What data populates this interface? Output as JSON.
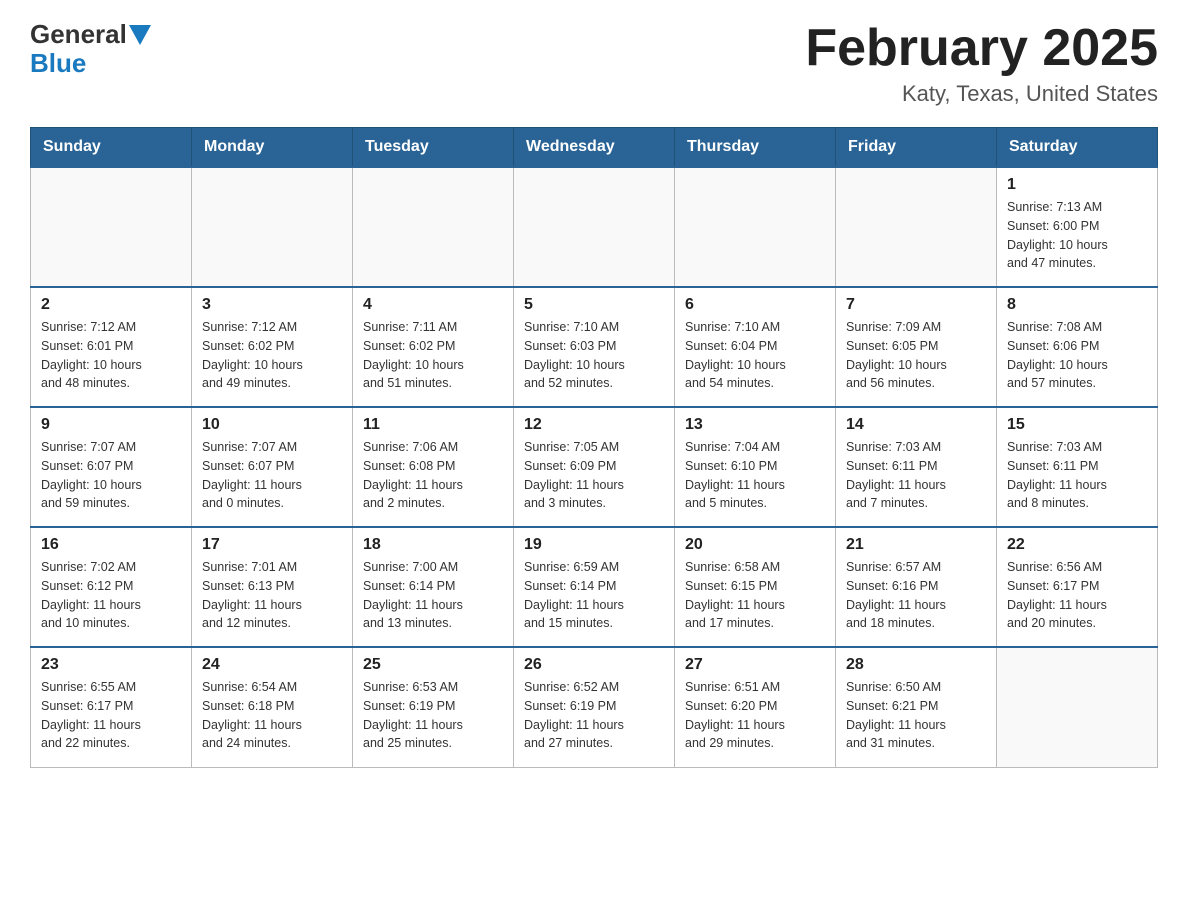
{
  "header": {
    "logo_general": "General",
    "logo_blue": "Blue",
    "title": "February 2025",
    "subtitle": "Katy, Texas, United States"
  },
  "days_of_week": [
    "Sunday",
    "Monday",
    "Tuesday",
    "Wednesday",
    "Thursday",
    "Friday",
    "Saturday"
  ],
  "weeks": [
    [
      {
        "day": "",
        "info": ""
      },
      {
        "day": "",
        "info": ""
      },
      {
        "day": "",
        "info": ""
      },
      {
        "day": "",
        "info": ""
      },
      {
        "day": "",
        "info": ""
      },
      {
        "day": "",
        "info": ""
      },
      {
        "day": "1",
        "info": "Sunrise: 7:13 AM\nSunset: 6:00 PM\nDaylight: 10 hours\nand 47 minutes."
      }
    ],
    [
      {
        "day": "2",
        "info": "Sunrise: 7:12 AM\nSunset: 6:01 PM\nDaylight: 10 hours\nand 48 minutes."
      },
      {
        "day": "3",
        "info": "Sunrise: 7:12 AM\nSunset: 6:02 PM\nDaylight: 10 hours\nand 49 minutes."
      },
      {
        "day": "4",
        "info": "Sunrise: 7:11 AM\nSunset: 6:02 PM\nDaylight: 10 hours\nand 51 minutes."
      },
      {
        "day": "5",
        "info": "Sunrise: 7:10 AM\nSunset: 6:03 PM\nDaylight: 10 hours\nand 52 minutes."
      },
      {
        "day": "6",
        "info": "Sunrise: 7:10 AM\nSunset: 6:04 PM\nDaylight: 10 hours\nand 54 minutes."
      },
      {
        "day": "7",
        "info": "Sunrise: 7:09 AM\nSunset: 6:05 PM\nDaylight: 10 hours\nand 56 minutes."
      },
      {
        "day": "8",
        "info": "Sunrise: 7:08 AM\nSunset: 6:06 PM\nDaylight: 10 hours\nand 57 minutes."
      }
    ],
    [
      {
        "day": "9",
        "info": "Sunrise: 7:07 AM\nSunset: 6:07 PM\nDaylight: 10 hours\nand 59 minutes."
      },
      {
        "day": "10",
        "info": "Sunrise: 7:07 AM\nSunset: 6:07 PM\nDaylight: 11 hours\nand 0 minutes."
      },
      {
        "day": "11",
        "info": "Sunrise: 7:06 AM\nSunset: 6:08 PM\nDaylight: 11 hours\nand 2 minutes."
      },
      {
        "day": "12",
        "info": "Sunrise: 7:05 AM\nSunset: 6:09 PM\nDaylight: 11 hours\nand 3 minutes."
      },
      {
        "day": "13",
        "info": "Sunrise: 7:04 AM\nSunset: 6:10 PM\nDaylight: 11 hours\nand 5 minutes."
      },
      {
        "day": "14",
        "info": "Sunrise: 7:03 AM\nSunset: 6:11 PM\nDaylight: 11 hours\nand 7 minutes."
      },
      {
        "day": "15",
        "info": "Sunrise: 7:03 AM\nSunset: 6:11 PM\nDaylight: 11 hours\nand 8 minutes."
      }
    ],
    [
      {
        "day": "16",
        "info": "Sunrise: 7:02 AM\nSunset: 6:12 PM\nDaylight: 11 hours\nand 10 minutes."
      },
      {
        "day": "17",
        "info": "Sunrise: 7:01 AM\nSunset: 6:13 PM\nDaylight: 11 hours\nand 12 minutes."
      },
      {
        "day": "18",
        "info": "Sunrise: 7:00 AM\nSunset: 6:14 PM\nDaylight: 11 hours\nand 13 minutes."
      },
      {
        "day": "19",
        "info": "Sunrise: 6:59 AM\nSunset: 6:14 PM\nDaylight: 11 hours\nand 15 minutes."
      },
      {
        "day": "20",
        "info": "Sunrise: 6:58 AM\nSunset: 6:15 PM\nDaylight: 11 hours\nand 17 minutes."
      },
      {
        "day": "21",
        "info": "Sunrise: 6:57 AM\nSunset: 6:16 PM\nDaylight: 11 hours\nand 18 minutes."
      },
      {
        "day": "22",
        "info": "Sunrise: 6:56 AM\nSunset: 6:17 PM\nDaylight: 11 hours\nand 20 minutes."
      }
    ],
    [
      {
        "day": "23",
        "info": "Sunrise: 6:55 AM\nSunset: 6:17 PM\nDaylight: 11 hours\nand 22 minutes."
      },
      {
        "day": "24",
        "info": "Sunrise: 6:54 AM\nSunset: 6:18 PM\nDaylight: 11 hours\nand 24 minutes."
      },
      {
        "day": "25",
        "info": "Sunrise: 6:53 AM\nSunset: 6:19 PM\nDaylight: 11 hours\nand 25 minutes."
      },
      {
        "day": "26",
        "info": "Sunrise: 6:52 AM\nSunset: 6:19 PM\nDaylight: 11 hours\nand 27 minutes."
      },
      {
        "day": "27",
        "info": "Sunrise: 6:51 AM\nSunset: 6:20 PM\nDaylight: 11 hours\nand 29 minutes."
      },
      {
        "day": "28",
        "info": "Sunrise: 6:50 AM\nSunset: 6:21 PM\nDaylight: 11 hours\nand 31 minutes."
      },
      {
        "day": "",
        "info": ""
      }
    ]
  ]
}
